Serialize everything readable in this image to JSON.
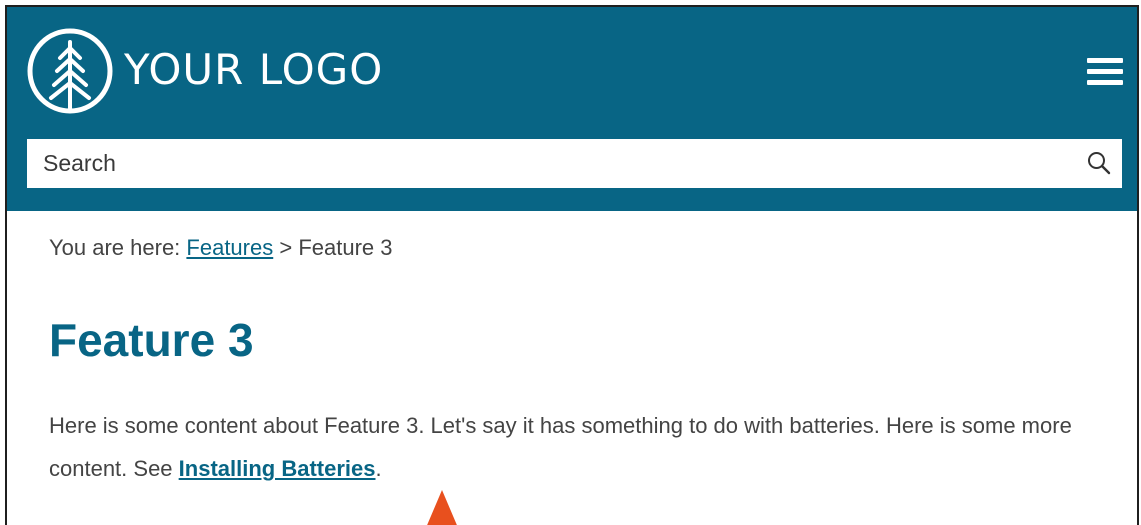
{
  "header": {
    "logo_text": "YOUR LOGO",
    "background_color": "#086585",
    "logo_icon": "pine-tree-icon",
    "menu_icon": "hamburger-menu-icon"
  },
  "search": {
    "placeholder": "Search",
    "icon": "search-icon"
  },
  "breadcrumb": {
    "prefix": "You are here: ",
    "link_label": "Features",
    "separator": " > ",
    "current": "Feature 3"
  },
  "main": {
    "title": "Feature 3",
    "paragraph_text": "Here is some content about Feature 3. Let's say it has something to do with batteries. Here is some more content. See ",
    "link_label": "Installing Batteries",
    "paragraph_end": ".",
    "accent_color": "#086585",
    "pointer_color": "#e8501e"
  }
}
